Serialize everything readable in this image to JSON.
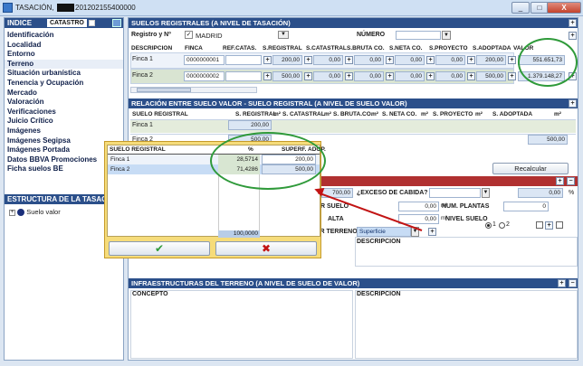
{
  "window": {
    "title_prefix": "TASACIÓN,",
    "title_suffix": "201202155400000",
    "btn_min": "_",
    "btn_max": "□",
    "btn_close": "X"
  },
  "sidebar": {
    "header": "INDICE",
    "header_tab": "CATASTRO",
    "items": [
      {
        "label": "Identificación"
      },
      {
        "label": "Localidad"
      },
      {
        "label": "Entorno"
      },
      {
        "label": "Terreno"
      },
      {
        "label": "Situación urbanística"
      },
      {
        "label": "Tenencia y Ocupación"
      },
      {
        "label": "Mercado"
      },
      {
        "label": "Valoración"
      },
      {
        "label": "Verificaciones"
      },
      {
        "label": "Juicio Crítico"
      },
      {
        "label": "Imágenes"
      },
      {
        "label": "Imágenes Segipsa"
      },
      {
        "label": "Imágenes Portada"
      },
      {
        "label": "Datos BBVA Promociones"
      },
      {
        "label": "Ficha suelos BE"
      }
    ],
    "structure_header": "ESTRUCTURA DE LA TASACIÓN",
    "tree_node": "Suelo valor"
  },
  "registrales": {
    "header": "SUELOS REGISTRALES (A NIVEL DE TASACIÓN)",
    "registro_label": "Registro y Nº",
    "registro_value": "MADRID",
    "numero_label": "NÚMERO",
    "columns": [
      "DESCRIPCIÓN",
      "FINCA",
      "REF.CATAS.",
      "S.REGISTRAL",
      "S.CATASTRAL",
      "S.BRUTA CO.",
      "S.NETA CO.",
      "S.PROYECTO",
      "S.ADOPTADA",
      "VALOR"
    ],
    "rows": [
      {
        "desc": "Finca 1",
        "finca": "0000000001",
        "registral": "200,00",
        "catastral": "0,00",
        "bruta": "0,00",
        "neta": "0,00",
        "proyecto": "0,00",
        "adoptada": "200,00",
        "valor": "551.651,73"
      },
      {
        "desc": "Finca 2",
        "finca": "0000000002",
        "registral": "500,00",
        "catastral": "0,00",
        "bruta": "0,00",
        "neta": "0,00",
        "proyecto": "0,00",
        "adoptada": "500,00",
        "valor": "1.379.148,27"
      }
    ]
  },
  "relacion": {
    "header": "RELACIÓN ENTRE SUELO VALOR - SUELO REGISTRAL (A NIVEL DE SUELO VALOR)",
    "columns": [
      "SUELO REGISTRAL",
      "S. REGISTRAL",
      "m²",
      "S. CATASTRAL",
      "m²",
      "S. BRUTA.CO.",
      "m²",
      "S. NETA CO.",
      "m²",
      "S. PROYECTO",
      "m²",
      "S. ADOPTADA",
      "m²"
    ],
    "rows": [
      {
        "name": "Finca 1",
        "registral": "200,00"
      },
      {
        "name": "Finca 2",
        "registral": "500,00",
        "adoptada": "500,00"
      }
    ],
    "recalcular": "Recalcular"
  },
  "form": {
    "total_value": "700,00",
    "exceso_label": "¿EXCESO DE CABIDA?",
    "exceso_value": "0,00",
    "exceso_unit": "%",
    "suelo_label": "R SUELO",
    "suelo_value": "0,00",
    "suelo_unit": "m²",
    "alta_label": "ALTA",
    "alta_value": "0,00",
    "alta_unit": "m²",
    "plantas_label": "NUM. PLANTAS",
    "plantas_value": "0",
    "nivel_label": "NIVEL SUELO",
    "radio1": "1",
    "radio2": "2",
    "terreno_label": "OR TERRENO",
    "terreno_value": "Superficie",
    "descripcion_label": "DESCRIPCION"
  },
  "infra": {
    "header": "INFRAESTRUCTURAS DEL TERRENO (A NIVEL DE SUELO DE VALOR)",
    "concepto_label": "CONCEPTO",
    "descripcion_label": "DESCRIPCION"
  },
  "popup": {
    "col_name": "SUELO REGISTRAL",
    "col_pct": "%",
    "col_adop": "SUPERF. ADOP.",
    "rows": [
      {
        "name": "Finca 1",
        "pct": "28,5714",
        "adop": "200,00"
      },
      {
        "name": "Finca 2",
        "pct": "71,4286",
        "adop": "500,00"
      }
    ],
    "total": "100,0000",
    "ok_glyph": "✔",
    "cancel_glyph": "✖"
  },
  "colors": {
    "header_blue": "#2b4f8a",
    "annotation_green": "#2f9a3a",
    "annotation_red": "#c21414",
    "popup_yellow": "#f6dc7a"
  }
}
